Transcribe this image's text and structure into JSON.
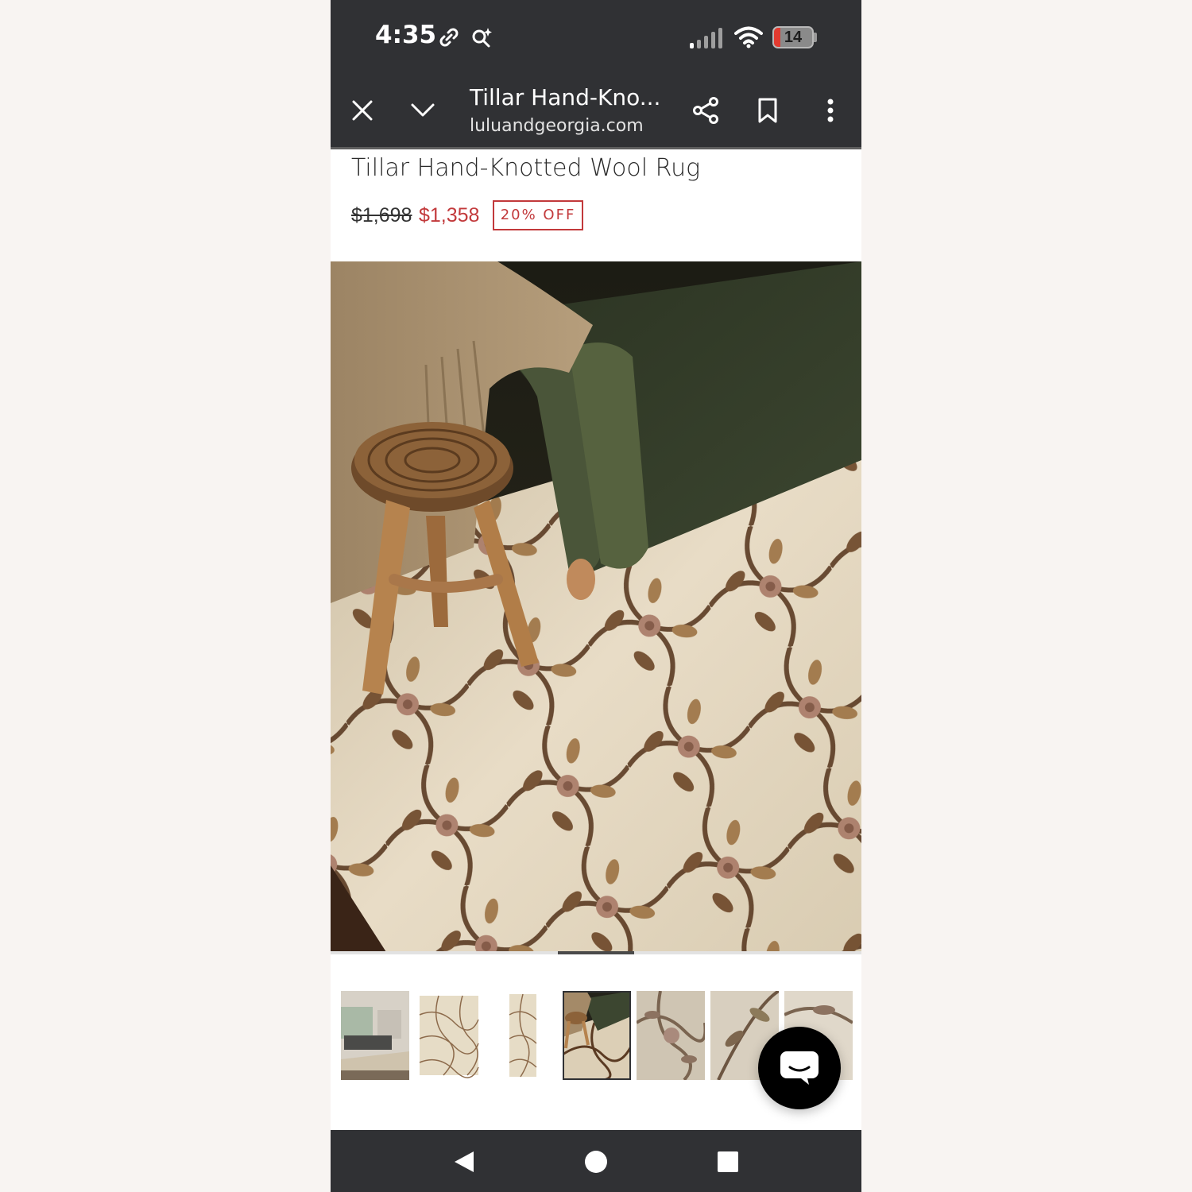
{
  "status_bar": {
    "time": "4:35",
    "battery_level": "14",
    "icons": [
      "link-icon",
      "search-sparkle-icon",
      "signal-icon",
      "wifi-icon",
      "battery-icon"
    ]
  },
  "browser": {
    "tab_title": "Tillar Hand-Kno...",
    "url": "luluandgeorgia.com",
    "icons": [
      "close-icon",
      "chevron-down-icon",
      "share-icon",
      "bookmark-icon",
      "more-vert-icon"
    ]
  },
  "product": {
    "title": "Tillar Hand-Knotted Wool Rug",
    "price_original": "$1,698",
    "price_sale": "$1,358",
    "discount": "20% OFF"
  },
  "gallery": {
    "thumbnail_count": 7,
    "selected_index": 3
  },
  "nav": {
    "icons": [
      "back-icon",
      "home-icon",
      "recents-icon"
    ]
  },
  "colors": {
    "chrome": "#303134",
    "sale_red": "#c2393b",
    "rug_cream": "#ece1cf",
    "vine_brown": "#5a3a22"
  }
}
